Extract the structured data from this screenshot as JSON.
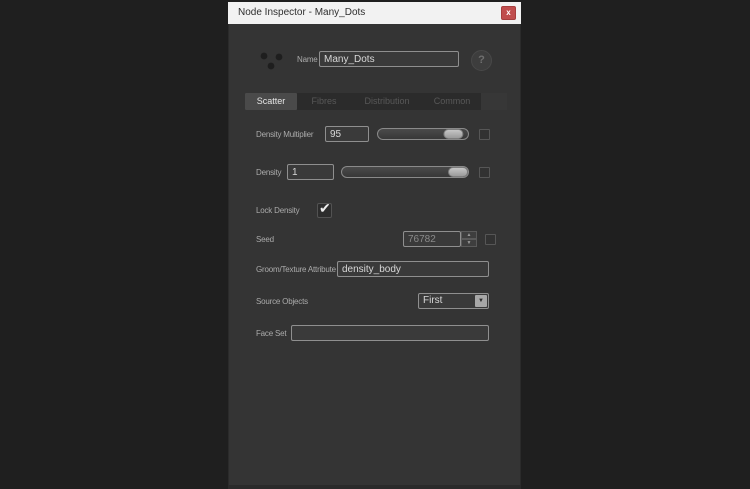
{
  "window": {
    "title": "Node Inspector - Many_Dots"
  },
  "icons": {
    "close": "x",
    "help": "?",
    "check": "✔",
    "spinner_up": "▲",
    "spinner_down": "▼",
    "dropdown_arrow": "▼"
  },
  "header": {
    "name_label": "Name",
    "name_value": "Many_Dots"
  },
  "tabs": [
    {
      "label": "Scatter",
      "active": true
    },
    {
      "label": "Fibres",
      "active": false
    },
    {
      "label": "Distribution",
      "active": false
    },
    {
      "label": "Common",
      "active": false
    }
  ],
  "fields": {
    "density_multiplier": {
      "label": "Density Multiplier",
      "value": "95",
      "slider_percent": 93
    },
    "density": {
      "label": "Density",
      "value": "1",
      "slider_percent": 100
    },
    "lock_density": {
      "label": "Lock Density",
      "checked": true
    },
    "seed": {
      "label": "Seed",
      "value": "76782"
    },
    "groom_texture_attribute": {
      "label": "Groom/Texture Attribute",
      "value": "density_body"
    },
    "source_objects": {
      "label": "Source Objects",
      "value": "First"
    },
    "face_set": {
      "label": "Face Set",
      "value": ""
    }
  },
  "colors": {
    "outer_bg": "#1f1f1f",
    "panel_bg": "#343434",
    "titlebar_bg": "#f2f2f2",
    "close_button": "#c04d4d",
    "active_tab_bg": "#4a4a4a"
  }
}
